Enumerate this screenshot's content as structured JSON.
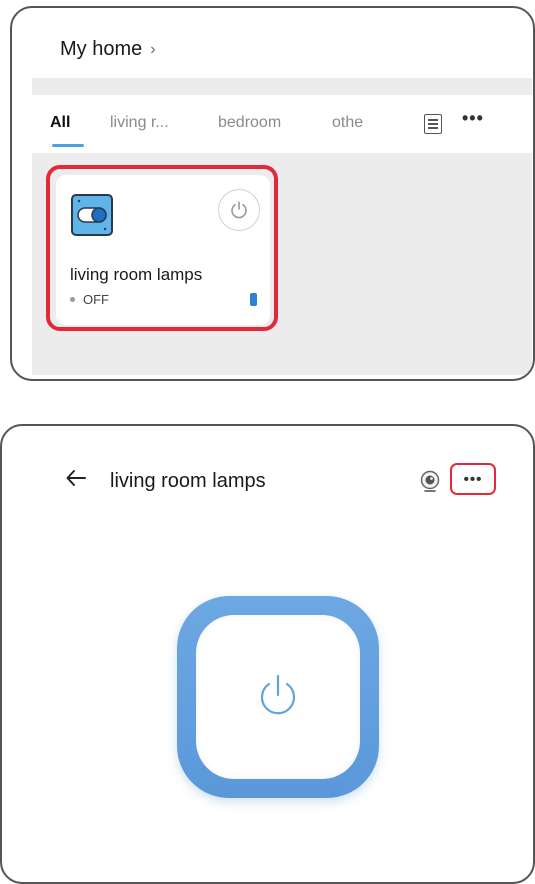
{
  "home": {
    "title": "My home",
    "tabs": [
      {
        "label": "All",
        "active": true
      },
      {
        "label": "living r...",
        "active": false
      },
      {
        "label": "bedroom",
        "active": false
      },
      {
        "label": "othe",
        "active": false
      }
    ],
    "device": {
      "name": "living room lamps",
      "status": "OFF"
    }
  },
  "detail": {
    "title": "living room lamps"
  },
  "icons": {
    "chevron": "chevron-right-icon",
    "list": "list-view-icon",
    "more": "more-horizontal-icon",
    "switch": "switch-device-icon",
    "power": "power-icon",
    "back": "arrow-left-icon",
    "camera": "camera-icon"
  },
  "colors": {
    "accent": "#4ba3de",
    "highlight": "#e4283a",
    "power_button": "#5a98da",
    "signal": "#2f7fd8"
  }
}
